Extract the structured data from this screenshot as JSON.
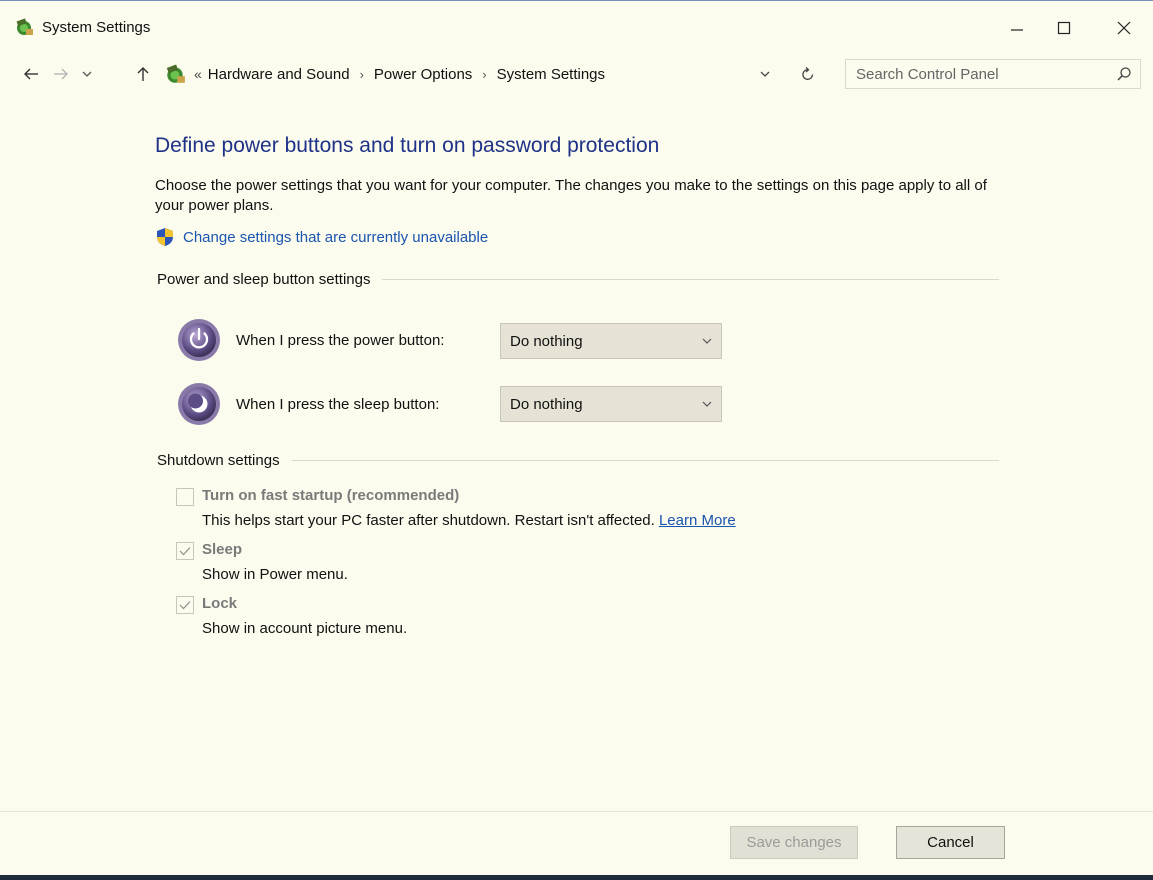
{
  "window": {
    "title": "System Settings",
    "icon": "control-panel-power-icon"
  },
  "nav": {
    "breadcrumb": [
      "Hardware and Sound",
      "Power Options",
      "System Settings"
    ],
    "overflow_glyph": "«",
    "search_placeholder": "Search Control Panel"
  },
  "main": {
    "title": "Define power buttons and turn on password protection",
    "description": "Choose the power settings that you want for your computer. The changes you make to the settings on this page apply to all of your power plans.",
    "change_link": "Change settings that are currently unavailable"
  },
  "power_section": {
    "label": "Power and sleep button settings",
    "power_button_label": "When I press the power button:",
    "power_button_value": "Do nothing",
    "sleep_button_label": "When I press the sleep button:",
    "sleep_button_value": "Do nothing"
  },
  "shutdown_section": {
    "label": "Shutdown settings",
    "fast_startup": {
      "title": "Turn on fast startup (recommended)",
      "description": "This helps start your PC faster after shutdown. Restart isn't affected.",
      "link": "Learn More",
      "checked": false
    },
    "sleep": {
      "title": "Sleep",
      "description": "Show in Power menu.",
      "checked": true
    },
    "lock": {
      "title": "Lock",
      "description": "Show in account picture menu.",
      "checked": true
    }
  },
  "footer": {
    "save_label": "Save changes",
    "cancel_label": "Cancel"
  },
  "colors": {
    "background": "#fbfbee",
    "title_blue": "#1e3287",
    "link_blue": "#1a55b0"
  }
}
